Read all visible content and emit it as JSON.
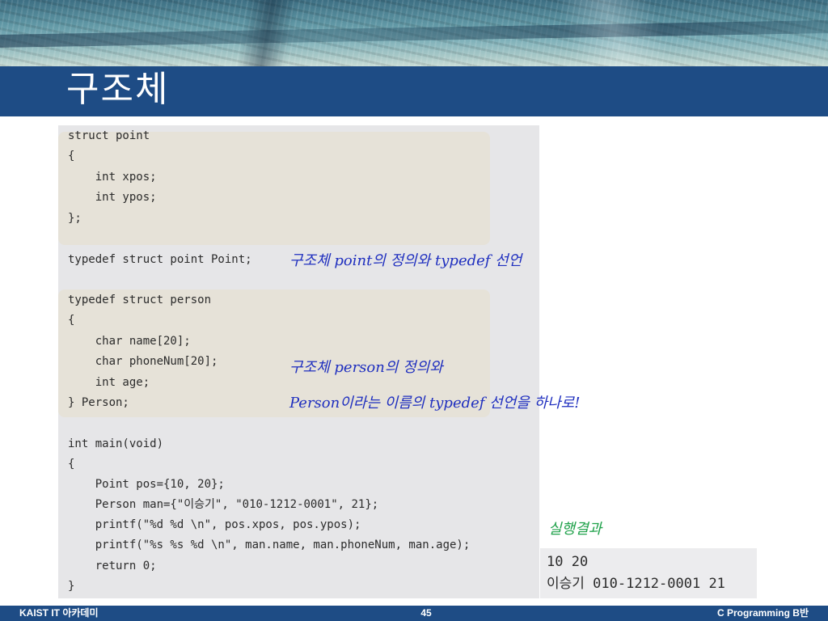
{
  "slide": {
    "title": "구조체"
  },
  "code": {
    "lines": [
      "struct point",
      "{",
      "    int xpos;",
      "    int ypos;",
      "};",
      "",
      "typedef struct point Point;",
      "",
      "typedef struct person",
      "{",
      "    char name[20];",
      "    char phoneNum[20];",
      "    int age;",
      "} Person;",
      "",
      "int main(void)",
      "{",
      "    Point pos={10, 20};",
      "    Person man={\"이승기\", \"010-1212-0001\", 21};",
      "    printf(\"%d %d \\n\", pos.xpos, pos.ypos);",
      "    printf(\"%s %s %d \\n\", man.name, man.phoneNum, man.age);",
      "    return 0;",
      "}"
    ]
  },
  "annotations": {
    "point_note": "구조체 point의 정의와 typedef 선언",
    "person_note_1": "구조체 person의 정의와",
    "person_note_2": "Person이라는 이름의 typedef 선언을 하나로!",
    "result_label": "실행결과"
  },
  "output": {
    "lines": [
      "10 20",
      "이승기 010-1212-0001 21"
    ]
  },
  "footer": {
    "left": "KAIST IT 아카데미",
    "page_number": "45",
    "right": "C Programming B반"
  },
  "colors": {
    "title_bar": "#1e4c85",
    "annotation_blue": "#1f2fbf",
    "annotation_green": "#1fa14a"
  }
}
